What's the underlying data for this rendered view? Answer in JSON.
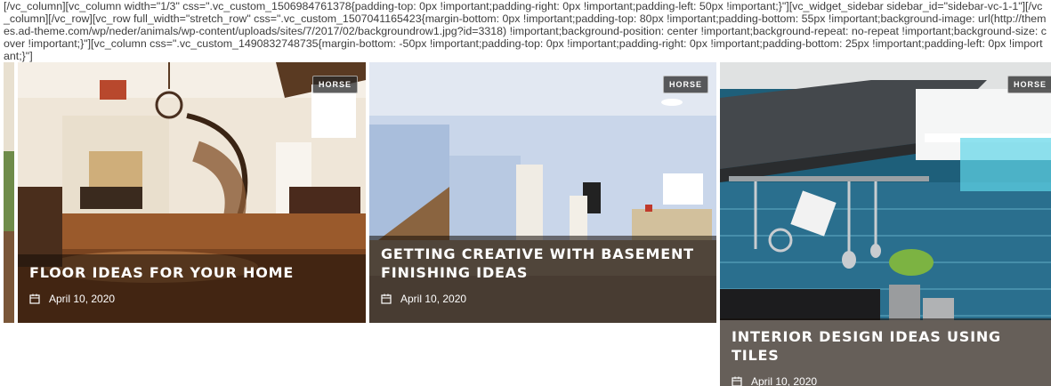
{
  "shortcode_text": "[/vc_column][vc_column width=\"1/3\" css=\".vc_custom_1506984761378{padding-top: 0px !important;padding-right: 0px !important;padding-left: 50px !important;}\"][vc_widget_sidebar sidebar_id=\"sidebar-vc-1-1\"][/vc_column][/vc_row][vc_row full_width=\"stretch_row\" css=\".vc_custom_1507041165423{margin-bottom: 0px !important;padding-top: 80px !important;padding-bottom: 55px !important;background-image: url(http://themes.ad-theme.com/wp/neder/animals/wp-content/uploads/sites/7/2017/02/backgroundrow1.jpg?id=3318) !important;background-position: center !important;background-repeat: no-repeat !important;background-size: cover !important;}\"][vc_column css=\".vc_custom_1490832748735{margin-bottom: -50px !important;padding-top: 0px !important;padding-right: 0px !important;padding-bottom: 25px !important;padding-left: 0px !important;}\"]",
  "posts": [
    {
      "category": "HORSE",
      "title": "FLOOR IDEAS FOR YOUR HOME",
      "date": "April 10, 2020",
      "icon": "calendar-icon"
    },
    {
      "category": "HORSE",
      "title": "GETTING CREATIVE WITH BASEMENT FINISHING IDEAS",
      "date": "April 10, 2020",
      "icon": "calendar-icon"
    },
    {
      "category": "HORSE",
      "title": "INTERIOR DESIGN IDEAS USING TILES",
      "date": "April 10, 2020",
      "icon": "calendar-icon"
    }
  ],
  "colors": {
    "overlay": "#140c08",
    "badge_bg": "#282828",
    "text": "#ffffff"
  }
}
